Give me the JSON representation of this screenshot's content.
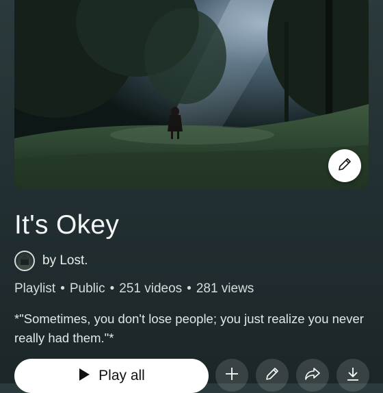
{
  "playlist": {
    "title": "It's Okey",
    "owner": "by Lost.",
    "meta": {
      "type": "Playlist",
      "visibility": "Public",
      "videos": "251 videos",
      "views": "281 views"
    },
    "description": "*\"Sometimes, you don't lose people; you just realize you never really had them.\"*"
  },
  "actions": {
    "play_all_label": "Play all"
  },
  "icons": {
    "edit_cover": "pencil-icon",
    "add": "plus-icon",
    "edit": "pencil-icon",
    "share": "share-icon",
    "download": "download-icon",
    "play": "play-icon"
  }
}
